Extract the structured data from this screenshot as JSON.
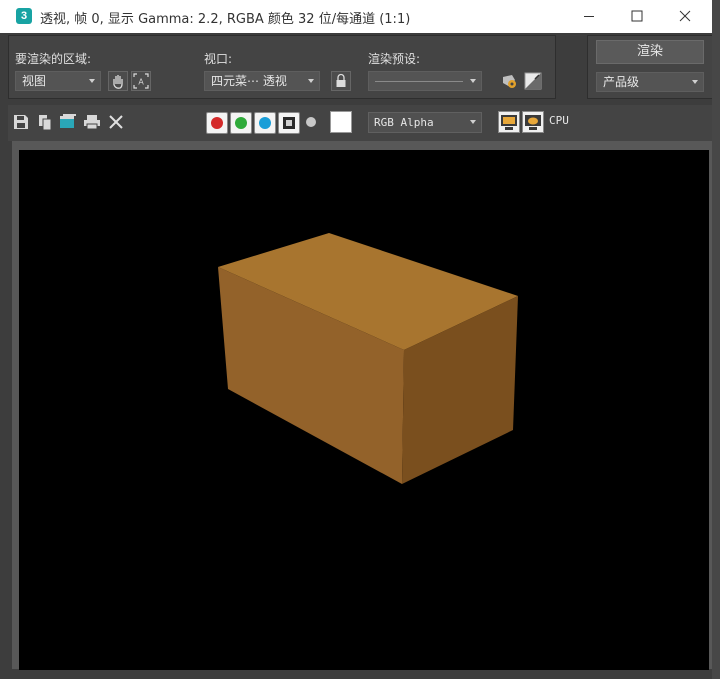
{
  "window": {
    "title": "透视, 帧 0, 显示 Gamma: 2.2, RGBA 颜色 32 位/每通道 (1:1)",
    "app_icon_text": "3"
  },
  "render_area": {
    "label": "要渲染的区域:",
    "value": "视图"
  },
  "viewport": {
    "label": "视口:",
    "value": "四元菜⋯ 透视"
  },
  "preset": {
    "label": "渲染预设:",
    "value": ""
  },
  "render": {
    "button_label": "渲染",
    "quality_value": "产品级"
  },
  "toolbar": {
    "channel_value": "RGB Alpha",
    "device_label": "CPU",
    "channel_colors": {
      "red": "#d42a2a",
      "green": "#2faa3a",
      "blue": "#1a9ed8"
    }
  },
  "scene": {
    "object": "orange-box",
    "colors": {
      "top": "#a8752f",
      "front_left": "#93622a",
      "front_right": "#7a4f1e"
    }
  }
}
